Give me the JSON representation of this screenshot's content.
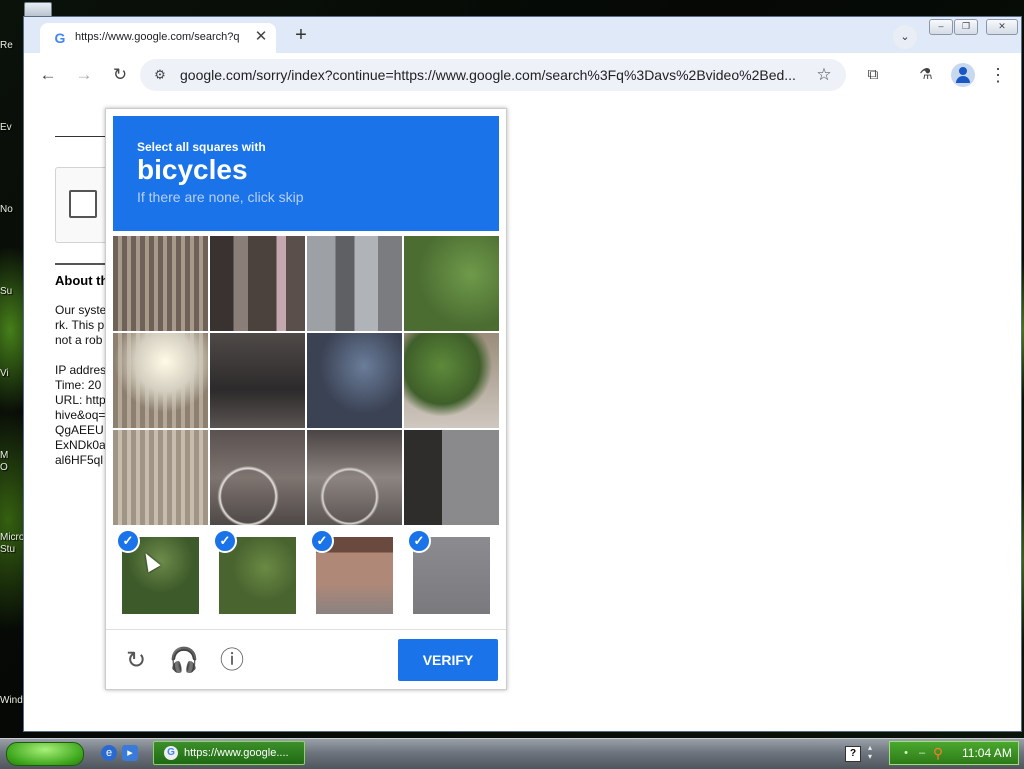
{
  "desktop": {
    "labels": [
      "Re",
      "Ev",
      "No",
      "Su",
      "Vi",
      "M",
      "O",
      "Micro",
      "Stu",
      "Wind"
    ]
  },
  "browser": {
    "tab_title": "https://www.google.com/search?q",
    "tab_favicon": "G",
    "tab_close": "✕",
    "new_tab": "+",
    "tab_search": "⌄",
    "url": "google.com/sorry/index?continue=https://www.google.com/search%3Fq%3Davs%2Bvideo%2Bed...",
    "icons": {
      "back": "←",
      "forward": "→",
      "reload": "↻",
      "site_info": "⚙",
      "bookmark": "☆",
      "extensions": "⧉",
      "labs": "⚗",
      "menu": "⋮"
    },
    "window_controls": {
      "minimize": "‒",
      "restore": "❐",
      "close": "✕"
    }
  },
  "page": {
    "about_heading": "About th",
    "para_lines": [
      "Our syste",
      "rk. This p",
      "not a rob"
    ],
    "info_lines": [
      "IP addres",
      "Time: 20",
      "URL: http",
      "hive&oq=",
      "QgAEEU",
      "ExNDk0a",
      "al6HF5ql"
    ]
  },
  "captcha": {
    "line1": "Select all squares with",
    "target": "bicycles",
    "hint": "If there are none, click skip",
    "verify_label": "VERIFY",
    "footer_icons": {
      "reload": "↻",
      "audio": "🎧",
      "info": "ⓘ"
    },
    "check_mark": "✓",
    "new_tiles_selected": [
      true,
      true,
      true,
      true
    ]
  },
  "taskbar": {
    "task_label": "https://www.google....",
    "task_icon": "G",
    "help": "?",
    "clock": "11:04 AM"
  },
  "colors": {
    "captcha_blue": "#1a73e8",
    "taskbar_green": "#2d7a18"
  }
}
